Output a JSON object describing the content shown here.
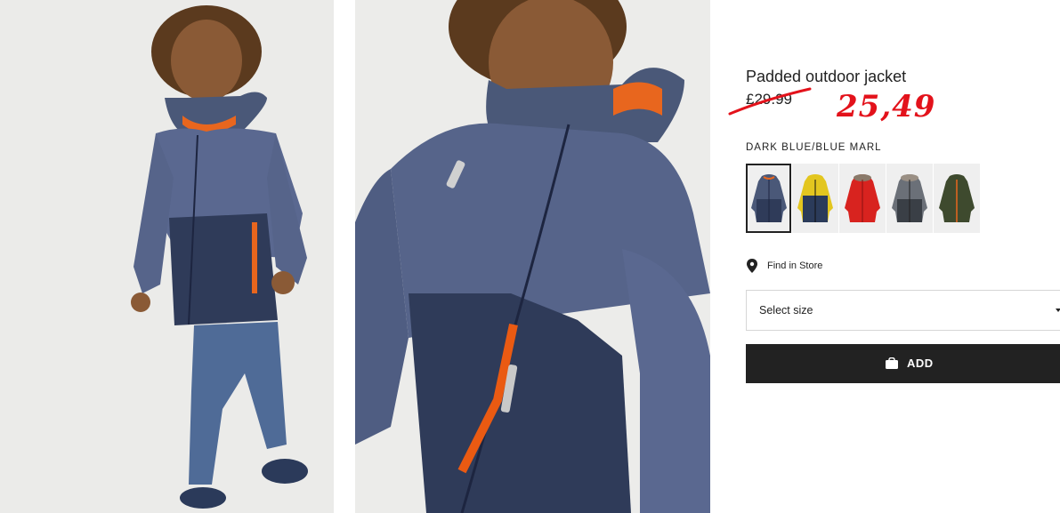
{
  "product": {
    "title": "Padded outdoor jacket",
    "original_price": "£29.99",
    "sale_price": "25,49",
    "color_name": "DARK BLUE/BLUE MARL"
  },
  "swatches": [
    {
      "name": "dark-blue-blue-marl",
      "body": "#3d4c6c",
      "top": "#5a6a8a",
      "accent": "#e8661e",
      "selected": true
    },
    {
      "name": "dark-blue-yellow",
      "body": "#2b3b5a",
      "top": "#e3c61f",
      "accent": "#e3c61f",
      "selected": false
    },
    {
      "name": "red",
      "body": "#d8231f",
      "top": "#d8231f",
      "accent": "#b01410",
      "selected": false
    },
    {
      "name": "dark-grey-fur",
      "body": "#3a3f46",
      "top": "#6b7078",
      "accent": "#6b7078",
      "selected": false
    },
    {
      "name": "khaki-green",
      "body": "#3e4a2e",
      "top": "#3e4a2e",
      "accent": "#e8661e",
      "selected": false
    }
  ],
  "store": {
    "find_in_store": "Find in Store",
    "pin_icon": "map-pin-icon"
  },
  "size": {
    "placeholder": "Select size"
  },
  "cart": {
    "add_label": "ADD",
    "bag_icon": "shopping-bag-icon"
  },
  "colors": {
    "sale_red": "#e3121b",
    "button_bg": "#222222",
    "text": "#222222"
  }
}
